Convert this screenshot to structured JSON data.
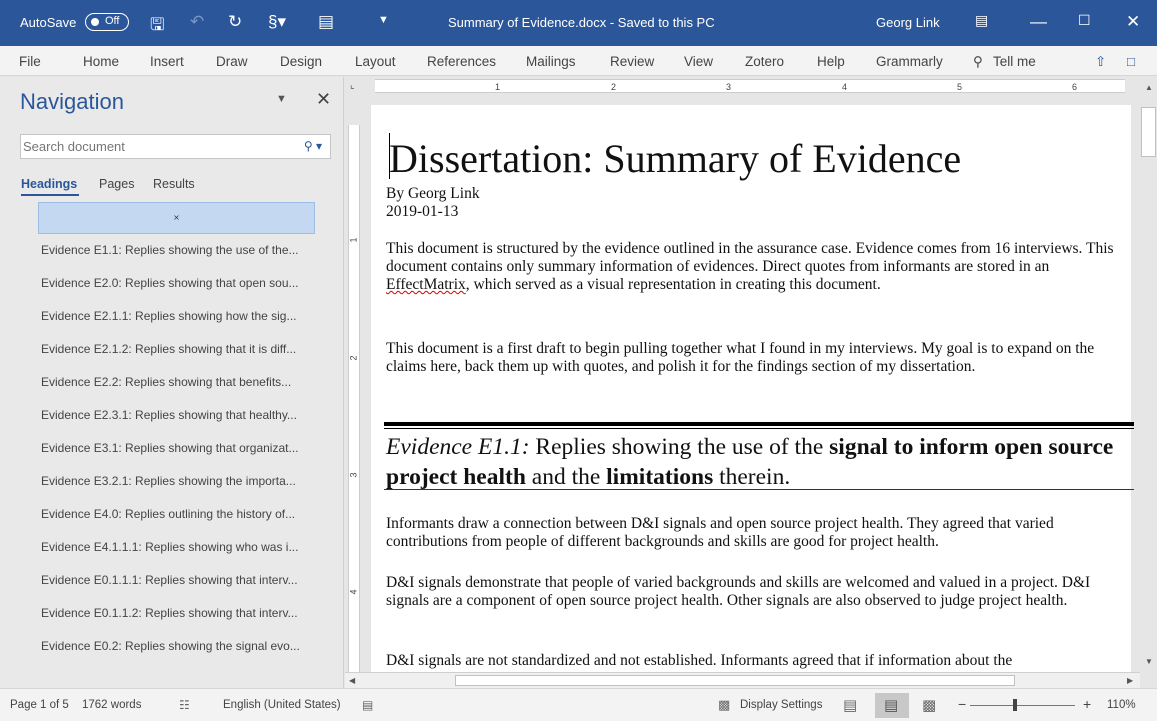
{
  "window": {
    "autosave_label": "AutoSave",
    "autosave_state": "Off",
    "doc_title": "Summary of Evidence.docx  -  Saved to this PC",
    "user": "Georg Link",
    "accent_color": "#2b579a"
  },
  "menu": [
    "File",
    "Home",
    "Insert",
    "Draw",
    "Design",
    "Layout",
    "References",
    "Mailings",
    "Review",
    "View",
    "Zotero",
    "Help",
    "Grammarly",
    "Tell me"
  ],
  "nav": {
    "title": "Navigation",
    "search_placeholder": "Search document",
    "tabs": [
      "Headings",
      "Pages",
      "Results"
    ],
    "selected_item_marker": "⨯",
    "items": [
      "Evidence E1.1: Replies showing the use of the...",
      "Evidence E2.0: Replies showing that open sou...",
      "Evidence E2.1.1: Replies showing how the sig...",
      "Evidence E2.1.2: Replies showing that it is diff...",
      "Evidence E2.2: Replies showing that benefits...",
      "Evidence E2.3.1: Replies showing that healthy...",
      "Evidence E3.1: Replies showing that organizat...",
      "Evidence E3.2.1: Replies showing the importa...",
      "Evidence E4.0: Replies outlining the history of...",
      "Evidence E4.1.1.1: Replies showing who was i...",
      "Evidence E0.1.1.1: Replies showing that interv...",
      "Evidence E0.1.1.2: Replies showing that interv...",
      "Evidence E0.2: Replies showing the signal evo..."
    ]
  },
  "ruler": {
    "top_numbers": [
      "1",
      "2",
      "3",
      "4",
      "5",
      "6"
    ],
    "left_numbers": [
      "1",
      "2",
      "3",
      "4"
    ]
  },
  "document": {
    "title": "Dissertation: Summary of Evidence",
    "author": "By Georg Link",
    "date": "2019-01-13",
    "para1_before": "This document is structured by the evidence outlined in the assurance case. Evidence comes from 16 interviews. This document contains only summary information of evidences. Direct quotes from informants are stored in an ",
    "para1_misspelled": "EffectMatrix",
    "para1_after": ", which served as a visual representation in creating this document.",
    "para2": "This document is a first draft to begin pulling together what I found in my interviews. My goal is to expand on the claims here, back them up with quotes, and polish it for the findings section of my dissertation.",
    "heading": {
      "label": "Evidence E1.1:",
      "t1": " Replies showing the use of the ",
      "b1": "signal to inform open source project health",
      "t2": " and the ",
      "b2": "limitations",
      "t3": " therein."
    },
    "para3": "Informants draw a connection between D&I signals and open source project health. They agreed that varied contributions from people of different backgrounds and skills are good for project health.",
    "para4": "D&I signals demonstrate that people of varied backgrounds and skills are welcomed and valued in a project. D&I signals are a component of open source project health. Other signals are also observed to judge project health.",
    "para5": "D&I signals are not standardized and not established. Informants agreed that if information about the"
  },
  "status": {
    "page": "Page 1 of 5",
    "words": "1762 words",
    "language": "English (United States)",
    "display_settings": "Display Settings",
    "zoom": "110%"
  }
}
